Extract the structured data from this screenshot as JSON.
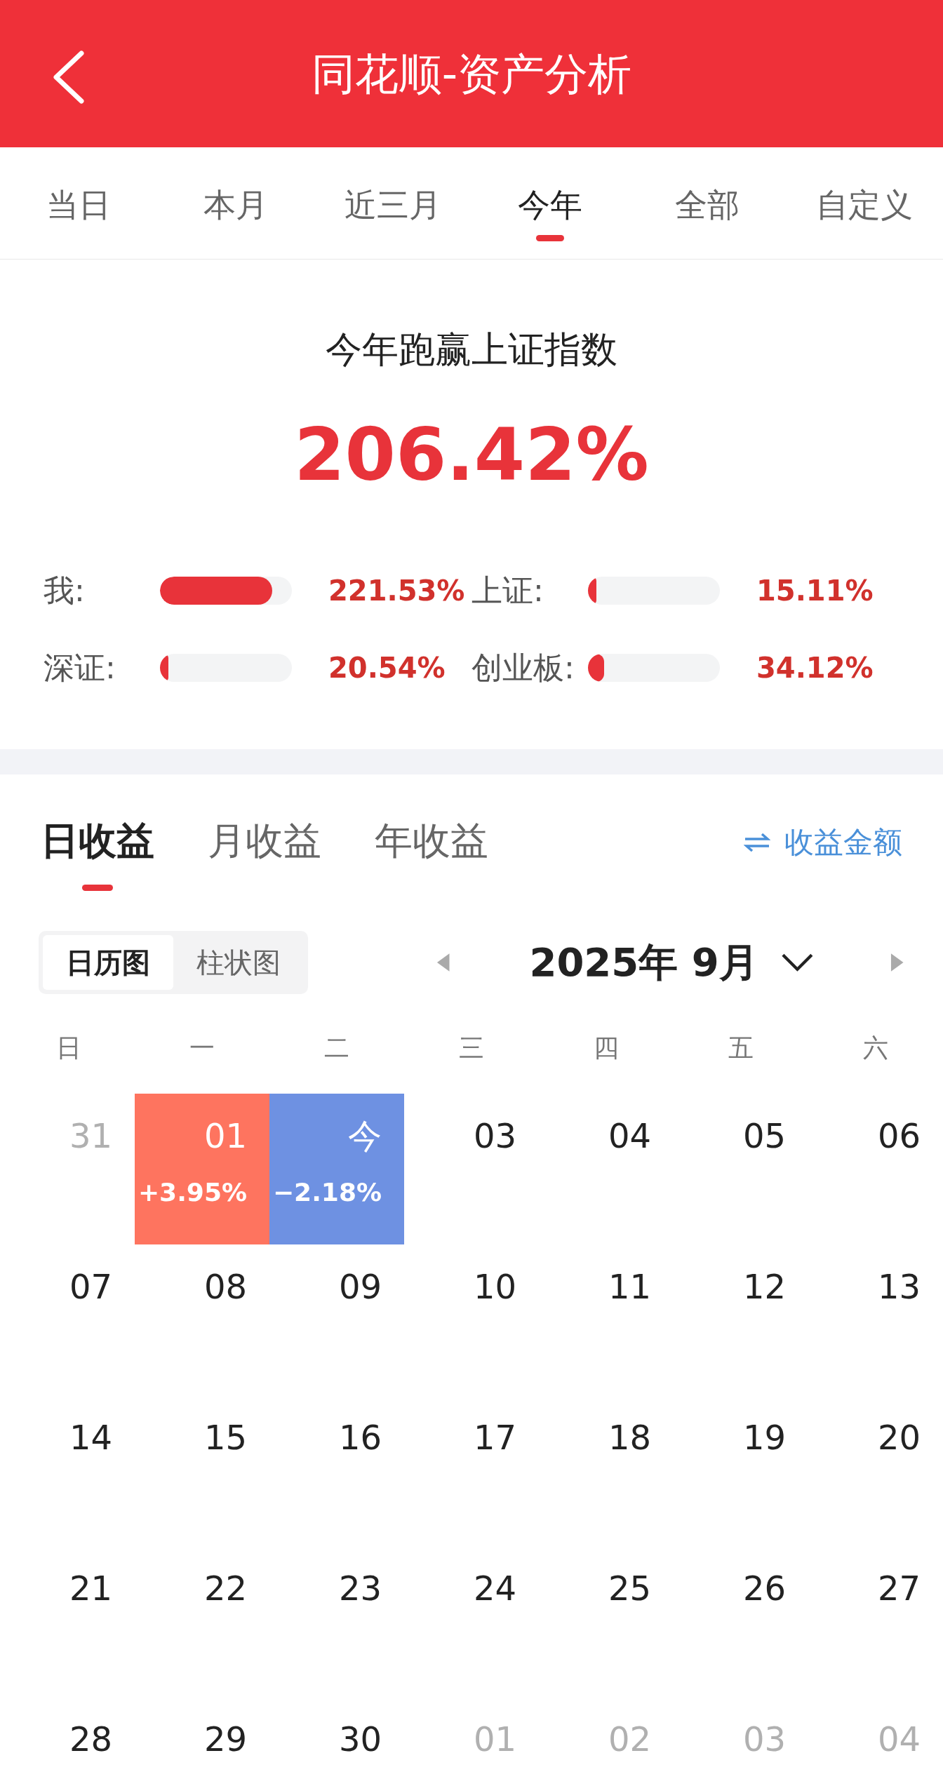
{
  "header": {
    "title": "同花顺-资产分析"
  },
  "period_tabs": [
    {
      "label": "当日",
      "selected": false
    },
    {
      "label": "本月",
      "selected": false
    },
    {
      "label": "近三月",
      "selected": false
    },
    {
      "label": "今年",
      "selected": true
    },
    {
      "label": "全部",
      "selected": false
    },
    {
      "label": "自定义",
      "selected": false
    }
  ],
  "summary": {
    "title": "今年跑赢上证指数",
    "value": "206.42%"
  },
  "comparisons": [
    {
      "label": "我:",
      "level": 0.85,
      "reading": "221.53%"
    },
    {
      "label": "上证:",
      "level": 0.06,
      "reading": "15.11%"
    },
    {
      "label": "深证:",
      "level": 0.06,
      "reading": "20.54%"
    },
    {
      "label": "创业板:",
      "level": 0.12,
      "reading": "34.12%"
    }
  ],
  "return_tabs": [
    {
      "label": "日收益",
      "selected": true
    },
    {
      "label": "月收益",
      "selected": false
    },
    {
      "label": "年收益",
      "selected": false
    }
  ],
  "toggle_link": "收益金额",
  "view_switch": [
    {
      "label": "日历图",
      "selected": true
    },
    {
      "label": "柱状图",
      "selected": false
    }
  ],
  "month": "2025年 9月",
  "weekdays": [
    "日",
    "一",
    "二",
    "三",
    "四",
    "五",
    "六"
  ],
  "days": [
    {
      "day": "31",
      "muted": true
    },
    {
      "day": "01",
      "muted": false,
      "change": "+3.95%",
      "color": "#fe745f"
    },
    {
      "day": "今",
      "muted": false,
      "change": "−2.18%",
      "color": "#6e91e2"
    },
    {
      "day": "03",
      "muted": false
    },
    {
      "day": "04",
      "muted": false
    },
    {
      "day": "05",
      "muted": false
    },
    {
      "day": "06",
      "muted": false
    },
    {
      "day": "07",
      "muted": false
    },
    {
      "day": "08",
      "muted": false
    },
    {
      "day": "09",
      "muted": false
    },
    {
      "day": "10",
      "muted": false
    },
    {
      "day": "11",
      "muted": false
    },
    {
      "day": "12",
      "muted": false
    },
    {
      "day": "13",
      "muted": false
    },
    {
      "day": "14",
      "muted": false
    },
    {
      "day": "15",
      "muted": false
    },
    {
      "day": "16",
      "muted": false
    },
    {
      "day": "17",
      "muted": false
    },
    {
      "day": "18",
      "muted": false
    },
    {
      "day": "19",
      "muted": false
    },
    {
      "day": "20",
      "muted": false
    },
    {
      "day": "21",
      "muted": false
    },
    {
      "day": "22",
      "muted": false
    },
    {
      "day": "23",
      "muted": false
    },
    {
      "day": "24",
      "muted": false
    },
    {
      "day": "25",
      "muted": false
    },
    {
      "day": "26",
      "muted": false
    },
    {
      "day": "27",
      "muted": false
    },
    {
      "day": "28",
      "muted": false
    },
    {
      "day": "29",
      "muted": false
    },
    {
      "day": "30",
      "muted": false
    },
    {
      "day": "01",
      "muted": true
    },
    {
      "day": "02",
      "muted": true
    },
    {
      "day": "03",
      "muted": true
    },
    {
      "day": "04",
      "muted": true
    }
  ]
}
